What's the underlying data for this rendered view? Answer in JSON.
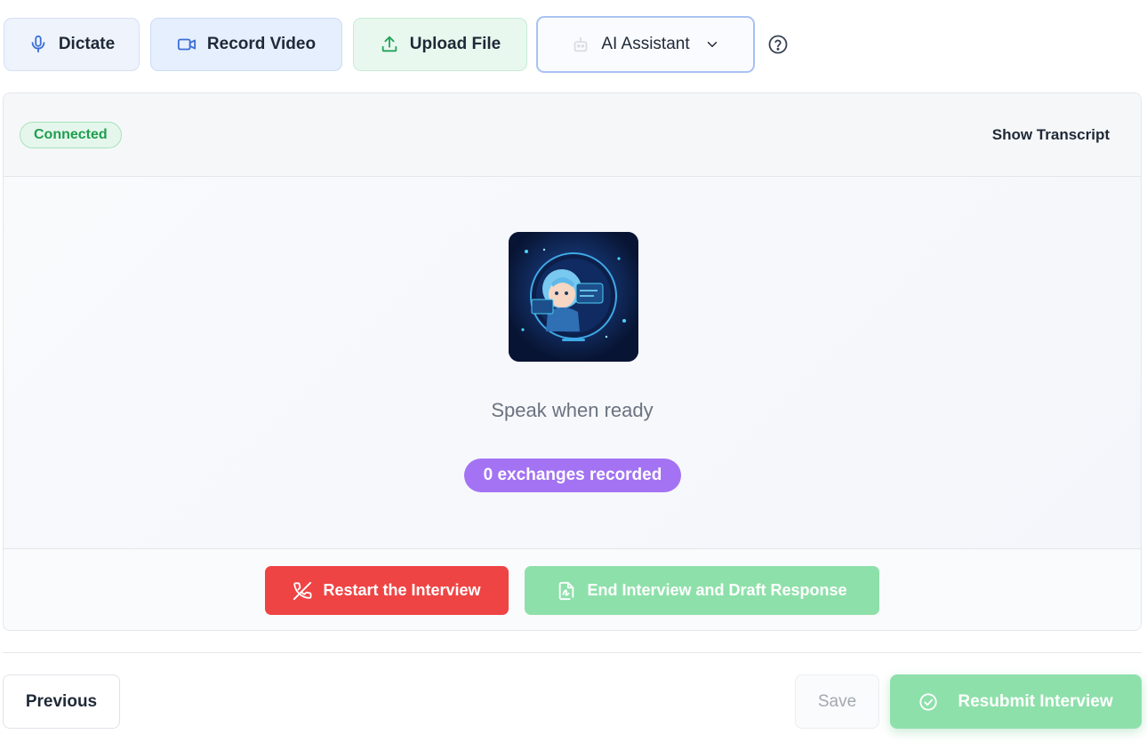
{
  "toolbar": {
    "dictate_label": "Dictate",
    "record_label": "Record Video",
    "upload_label": "Upload File",
    "ai_label": "AI Assistant"
  },
  "panel": {
    "status": "Connected",
    "show_transcript": "Show Transcript",
    "speak_prompt": "Speak when ready",
    "exchanges": "0 exchanges recorded",
    "restart_label": "Restart the Interview",
    "end_label": "End Interview and Draft Response"
  },
  "nav": {
    "previous_label": "Previous",
    "save_label": "Save",
    "resubmit_label": "Resubmit Interview"
  },
  "colors": {
    "connected": "#1f9d4f",
    "exchanges_badge": "#a373f3",
    "restart": "#ef4444",
    "success": "#8ee0aa"
  },
  "icons": {
    "dictate": "microphone-icon",
    "record": "video-camera-icon",
    "upload": "upload-icon",
    "ai": "robot-icon",
    "ai_menu": "chevron-down-icon",
    "help": "help-circle-icon",
    "restart": "phone-off-icon",
    "end": "file-signature-icon",
    "resubmit": "check-circle-icon"
  }
}
